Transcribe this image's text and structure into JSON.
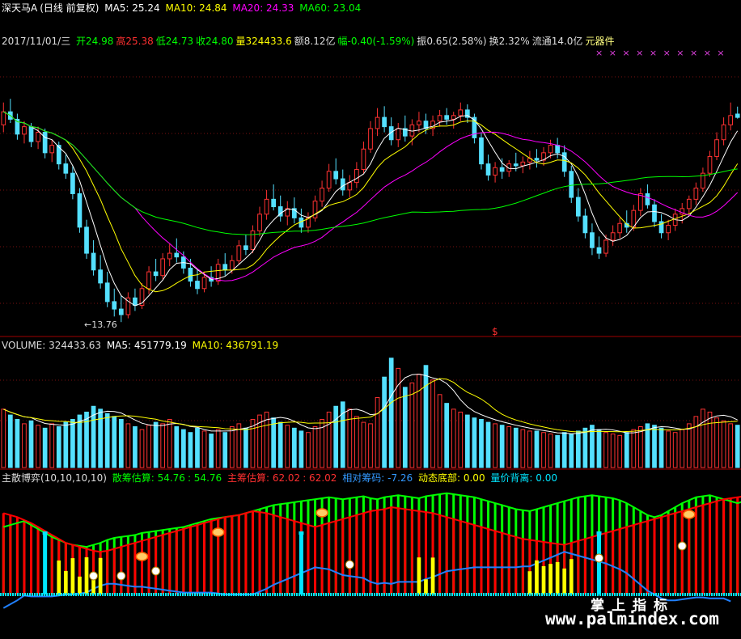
{
  "colors": {
    "background": "#000000",
    "up": "#ff3232",
    "down": "#54e0ff",
    "ma5": "#ffffff",
    "ma10": "#ffff00",
    "ma20": "#ff00ff",
    "ma60": "#00ff00",
    "grid": "#7a1010",
    "divider": "#a00000",
    "green_fill": "#00ff00",
    "red_fill": "#ff0000",
    "blue_line": "#2080ff",
    "yellow_fill": "#ffff00",
    "cyan_bar": "#00e6ff"
  },
  "header": {
    "stock_name": "深天马A",
    "mode": "(日线 前复权)",
    "ma5": "MA5: 25.24",
    "ma10": "MA10: 24.84",
    "ma20": "MA20: 24.33",
    "ma60": "MA60: 23.04"
  },
  "info_line": {
    "date": "2017/11/01/三",
    "open": "开24.98",
    "high": "高25.38",
    "low": "低24.73",
    "close": "收24.80",
    "volume": "量324433.6",
    "amount": "额8.12亿",
    "change": "幅-0.40(-1.59%)",
    "amplitude": "振0.65(2.58%)",
    "turnover": "换2.32%",
    "float": "流通14.0亿",
    "sector": "元器件"
  },
  "price_annotations": {
    "low_label": "←13.76",
    "dollar_mark": "$",
    "x_marks": "× ×   ×   × ×  ×   ×        ×  × ×"
  },
  "volume_header": {
    "title": "VOLUME: 324433.63",
    "ma5": "MA5: 451779.19",
    "ma10": "MA10: 436791.19"
  },
  "indicator_header": {
    "name": "主散博弈(10,10,10,10)",
    "retail_label": "散筹估算: 54.76",
    "retail_value": ": 54.76",
    "main_label": "主筹估算: 62.02",
    "main_value": ": 62.02",
    "relative": "相对筹码: -7.26",
    "bottom": "动态底部: 0.00",
    "divergence": "量价背离: 0.00"
  },
  "watermark": {
    "cn": "掌上指标",
    "url": "www.palmindex.com"
  },
  "chart_data": [
    {
      "type": "candlestick",
      "title": "深天马A (日线 前复权)",
      "ylim": [
        13.2,
        28.5
      ],
      "low_marker": 13.76,
      "ohlc": [
        [
          24.4,
          25.6,
          24.0,
          25.1
        ],
        [
          25.1,
          25.8,
          24.5,
          24.7
        ],
        [
          24.7,
          25.0,
          23.6,
          23.9
        ],
        [
          23.9,
          24.6,
          23.4,
          24.3
        ],
        [
          24.3,
          24.5,
          23.2,
          23.5
        ],
        [
          23.5,
          24.3,
          23.1,
          24.0
        ],
        [
          24.0,
          24.2,
          22.6,
          22.9
        ],
        [
          22.9,
          23.6,
          22.4,
          23.3
        ],
        [
          23.3,
          23.5,
          22.0,
          22.3
        ],
        [
          22.3,
          22.8,
          21.5,
          21.8
        ],
        [
          21.8,
          22.2,
          20.4,
          20.7
        ],
        [
          20.7,
          21.0,
          18.6,
          18.9
        ],
        [
          18.9,
          19.3,
          17.2,
          17.5
        ],
        [
          17.5,
          18.2,
          16.3,
          16.6
        ],
        [
          16.6,
          17.4,
          15.6,
          15.9
        ],
        [
          15.9,
          16.5,
          14.6,
          14.9
        ],
        [
          14.9,
          15.6,
          14.1,
          14.5
        ],
        [
          14.5,
          15.2,
          13.8,
          14.2
        ],
        [
          14.2,
          15.4,
          14.0,
          15.1
        ],
        [
          15.1,
          15.6,
          14.4,
          14.7
        ],
        [
          14.7,
          15.9,
          14.5,
          15.6
        ],
        [
          15.6,
          16.8,
          15.3,
          16.5
        ],
        [
          16.5,
          17.2,
          16.0,
          16.3
        ],
        [
          16.3,
          17.5,
          16.1,
          17.2
        ],
        [
          17.2,
          18.0,
          16.8,
          17.5
        ],
        [
          17.5,
          18.3,
          17.0,
          17.3
        ],
        [
          17.3,
          17.6,
          16.4,
          16.7
        ],
        [
          16.7,
          17.2,
          15.7,
          16.0
        ],
        [
          16.0,
          16.6,
          15.3,
          15.6
        ],
        [
          15.6,
          16.5,
          15.4,
          16.2
        ],
        [
          16.2,
          16.8,
          15.7,
          16.0
        ],
        [
          16.0,
          17.2,
          15.8,
          16.9
        ],
        [
          16.9,
          17.5,
          16.3,
          16.6
        ],
        [
          16.6,
          17.4,
          16.4,
          17.1
        ],
        [
          17.1,
          18.2,
          16.9,
          17.9
        ],
        [
          17.9,
          18.5,
          17.4,
          17.7
        ],
        [
          17.7,
          19.0,
          17.5,
          18.7
        ],
        [
          18.7,
          20.0,
          18.4,
          19.6
        ],
        [
          19.6,
          20.9,
          19.3,
          20.4
        ],
        [
          20.4,
          21.2,
          19.8,
          20.0
        ],
        [
          20.0,
          20.6,
          19.2,
          19.5
        ],
        [
          19.5,
          20.3,
          19.0,
          19.9
        ],
        [
          19.9,
          20.5,
          19.1,
          19.4
        ],
        [
          19.4,
          19.9,
          18.6,
          18.9
        ],
        [
          18.9,
          19.7,
          18.6,
          19.4
        ],
        [
          19.4,
          20.6,
          19.2,
          20.3
        ],
        [
          20.3,
          21.4,
          20.0,
          21.0
        ],
        [
          21.0,
          22.3,
          20.8,
          21.9
        ],
        [
          21.9,
          22.6,
          21.2,
          21.5
        ],
        [
          21.5,
          22.0,
          20.6,
          20.9
        ],
        [
          20.9,
          21.7,
          20.5,
          21.3
        ],
        [
          21.3,
          22.4,
          21.0,
          22.0
        ],
        [
          22.0,
          23.5,
          21.8,
          23.1
        ],
        [
          23.1,
          24.6,
          22.9,
          24.2
        ],
        [
          24.2,
          25.3,
          23.8,
          24.8
        ],
        [
          24.8,
          25.4,
          24.0,
          24.3
        ],
        [
          24.3,
          24.8,
          23.3,
          23.6
        ],
        [
          23.6,
          24.5,
          23.2,
          24.2
        ],
        [
          24.2,
          24.9,
          23.5,
          23.8
        ],
        [
          23.8,
          24.7,
          23.3,
          24.4
        ],
        [
          24.4,
          25.1,
          24.0,
          24.6
        ],
        [
          24.6,
          25.0,
          23.9,
          24.2
        ],
        [
          24.2,
          24.9,
          23.8,
          24.6
        ],
        [
          24.6,
          25.2,
          24.3,
          24.9
        ],
        [
          24.9,
          25.3,
          24.4,
          24.7
        ],
        [
          24.7,
          25.1,
          24.2,
          24.9
        ],
        [
          24.9,
          25.6,
          24.6,
          25.2
        ],
        [
          25.2,
          25.5,
          24.5,
          24.8
        ],
        [
          24.8,
          25.0,
          23.4,
          23.7
        ],
        [
          23.7,
          24.0,
          22.0,
          22.3
        ],
        [
          22.3,
          22.8,
          21.4,
          21.7
        ],
        [
          21.7,
          22.4,
          21.3,
          22.1
        ],
        [
          22.1,
          22.6,
          21.5,
          21.9
        ],
        [
          21.9,
          22.5,
          21.6,
          22.3
        ],
        [
          22.3,
          22.9,
          21.9,
          22.2
        ],
        [
          22.2,
          22.7,
          21.8,
          22.4
        ],
        [
          22.4,
          23.0,
          22.0,
          22.6
        ],
        [
          22.6,
          23.1,
          22.1,
          22.5
        ],
        [
          22.5,
          23.2,
          22.2,
          22.9
        ],
        [
          22.9,
          23.6,
          22.6,
          23.3
        ],
        [
          23.3,
          23.7,
          22.6,
          22.9
        ],
        [
          22.9,
          23.3,
          21.6,
          21.9
        ],
        [
          21.9,
          22.2,
          20.2,
          20.5
        ],
        [
          20.5,
          21.0,
          19.2,
          19.5
        ],
        [
          19.5,
          19.9,
          18.3,
          18.6
        ],
        [
          18.6,
          19.1,
          17.4,
          17.8
        ],
        [
          17.8,
          18.4,
          17.2,
          17.5
        ],
        [
          17.5,
          18.5,
          17.3,
          18.2
        ],
        [
          18.2,
          19.0,
          17.9,
          18.6
        ],
        [
          18.6,
          19.4,
          18.3,
          19.1
        ],
        [
          19.1,
          19.8,
          18.6,
          18.9
        ],
        [
          18.9,
          20.1,
          18.7,
          19.8
        ],
        [
          19.8,
          21.0,
          19.5,
          20.7
        ],
        [
          20.7,
          21.2,
          19.9,
          20.1
        ],
        [
          20.1,
          20.4,
          18.9,
          19.2
        ],
        [
          19.2,
          19.6,
          18.3,
          18.6
        ],
        [
          18.6,
          19.3,
          18.2,
          19.0
        ],
        [
          19.0,
          19.9,
          18.7,
          19.6
        ],
        [
          19.6,
          20.2,
          19.1,
          19.9
        ],
        [
          19.9,
          20.6,
          19.6,
          20.4
        ],
        [
          20.4,
          21.3,
          20.1,
          21.0
        ],
        [
          21.0,
          22.1,
          20.8,
          21.8
        ],
        [
          21.8,
          23.0,
          21.6,
          22.7
        ],
        [
          22.7,
          24.0,
          22.5,
          23.6
        ],
        [
          23.6,
          24.8,
          23.3,
          24.4
        ],
        [
          24.4,
          25.6,
          24.1,
          24.9
        ],
        [
          24.98,
          25.38,
          24.73,
          24.8
        ]
      ],
      "ma_labels": [
        "MA5",
        "MA10",
        "MA20",
        "MA60"
      ]
    },
    {
      "type": "bar",
      "title": "VOLUME",
      "values": [
        40,
        36,
        33,
        30,
        32,
        29,
        27,
        30,
        28,
        31,
        33,
        36,
        38,
        42,
        40,
        37,
        35,
        33,
        30,
        28,
        26,
        29,
        31,
        30,
        33,
        28,
        26,
        24,
        27,
        25,
        23,
        26,
        24,
        28,
        30,
        27,
        33,
        36,
        38,
        34,
        31,
        29,
        27,
        25,
        24,
        28,
        33,
        38,
        42,
        45,
        40,
        35,
        31,
        30,
        48,
        62,
        75,
        68,
        55,
        58,
        64,
        70,
        60,
        50,
        44,
        40,
        38,
        36,
        34,
        33,
        31,
        30,
        29,
        28,
        27,
        26,
        25,
        25,
        24,
        23,
        22,
        24,
        23,
        25,
        27,
        29,
        26,
        24,
        23,
        22,
        24,
        26,
        28,
        30,
        29,
        27,
        25,
        24,
        26,
        30,
        35,
        40,
        38,
        34,
        32,
        30,
        29
      ],
      "ma_labels": [
        "MA5",
        "MA10"
      ]
    },
    {
      "type": "area",
      "title": "主散博弈(10,10,10,10)",
      "series_names": [
        "散筹估算",
        "主筹估算",
        "相对筹码",
        "动态底部",
        "量价背离"
      ],
      "retail": [
        68,
        70,
        72,
        74,
        70,
        66,
        62,
        58,
        55,
        52,
        50,
        49,
        48,
        50,
        52,
        55,
        57,
        58,
        59,
        60,
        62,
        63,
        64,
        65,
        66,
        67,
        68,
        70,
        72,
        74,
        76,
        77,
        78,
        79,
        80,
        82,
        84,
        86,
        88,
        90,
        91,
        92,
        93,
        94,
        95,
        96,
        97,
        98,
        97,
        96,
        97,
        98,
        99,
        97,
        96,
        98,
        99,
        100,
        99,
        98,
        97,
        99,
        100,
        101,
        102,
        101,
        100,
        99,
        98,
        96,
        94,
        92,
        90,
        88,
        86,
        85,
        84,
        86,
        88,
        90,
        92,
        94,
        96,
        98,
        99,
        100,
        99,
        98,
        97,
        95,
        92,
        88,
        84,
        80,
        78,
        80,
        84,
        88,
        92,
        95,
        98,
        99,
        100,
        98,
        96,
        94,
        92,
        94
      ],
      "main": [
        82,
        80,
        78,
        75,
        72,
        68,
        64,
        60,
        56,
        52,
        50,
        48,
        46,
        44,
        43,
        44,
        46,
        48,
        50,
        52,
        54,
        56,
        58,
        60,
        62,
        64,
        66,
        68,
        70,
        72,
        74,
        76,
        78,
        79,
        80,
        82,
        84,
        83,
        82,
        80,
        78,
        76,
        74,
        72,
        70,
        68,
        70,
        72,
        74,
        76,
        78,
        80,
        82,
        84,
        85,
        86,
        88,
        87,
        86,
        85,
        84,
        83,
        82,
        80,
        78,
        76,
        74,
        72,
        70,
        68,
        66,
        64,
        62,
        60,
        58,
        56,
        55,
        54,
        53,
        52,
        51,
        50,
        52,
        54,
        56,
        58,
        60,
        62,
        64,
        66,
        68,
        70,
        72,
        74,
        76,
        78,
        80,
        82,
        84,
        86,
        88,
        90,
        92,
        94,
        96,
        97,
        98,
        99,
        100,
        101
      ],
      "relative": [
        -14,
        -10,
        -6,
        -1,
        -2,
        -2,
        -2,
        -2,
        -1,
        0,
        0,
        1,
        2,
        6,
        9,
        11,
        11,
        10,
        9,
        8,
        8,
        7,
        6,
        5,
        4,
        3,
        2,
        2,
        2,
        2,
        2,
        1,
        0,
        0,
        0,
        0,
        0,
        3,
        6,
        10,
        13,
        16,
        19,
        22,
        25,
        28,
        27,
        26,
        23,
        20,
        19,
        18,
        17,
        13,
        11,
        12,
        11,
        13,
        13,
        13,
        13,
        16,
        18,
        21,
        24,
        25,
        26,
        27,
        28,
        28,
        28,
        28,
        28,
        28,
        28,
        29,
        29,
        32,
        35,
        38,
        41,
        44,
        42,
        40,
        38,
        36,
        34,
        32,
        29,
        26,
        22,
        16,
        10,
        4,
        0,
        -4,
        -6,
        -6,
        -5,
        -4,
        -3,
        -3,
        -4,
        -4,
        -4,
        -7
      ]
    }
  ]
}
